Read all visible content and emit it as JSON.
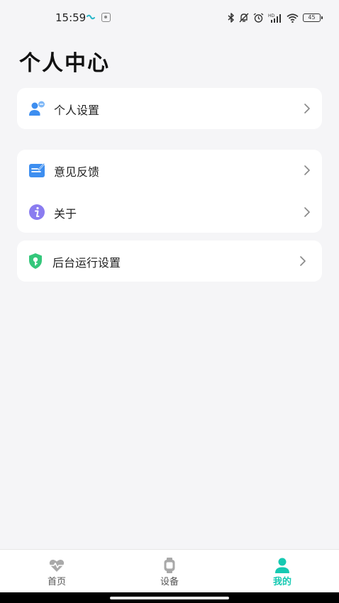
{
  "status_bar": {
    "time": "15:59",
    "battery": "45",
    "icons": [
      "bluetooth-icon",
      "mute-icon",
      "alarm-icon",
      "hd-signal-icon",
      "wifi-icon",
      "battery-icon"
    ]
  },
  "page": {
    "title": "个人中心"
  },
  "menu": {
    "personal_settings": {
      "label": "个人设置",
      "icon": "user-settings-icon"
    },
    "feedback": {
      "label": "意见反馈",
      "icon": "feedback-icon"
    },
    "about": {
      "label": "关于",
      "icon": "info-icon"
    },
    "background_settings": {
      "label": "后台运行设置",
      "icon": "shield-key-icon"
    }
  },
  "bottom_nav": {
    "items": [
      {
        "label": "首页",
        "icon": "heart-pulse-icon",
        "active": false
      },
      {
        "label": "设备",
        "icon": "watch-icon",
        "active": false
      },
      {
        "label": "我的",
        "icon": "person-icon",
        "active": true
      }
    ]
  },
  "colors": {
    "accent": "#16c9b2",
    "background": "#f5f5f7",
    "card": "#ffffff",
    "icon_blue": "#3d8ef0",
    "icon_purple": "#8a7cf0",
    "icon_green": "#34c77b"
  }
}
